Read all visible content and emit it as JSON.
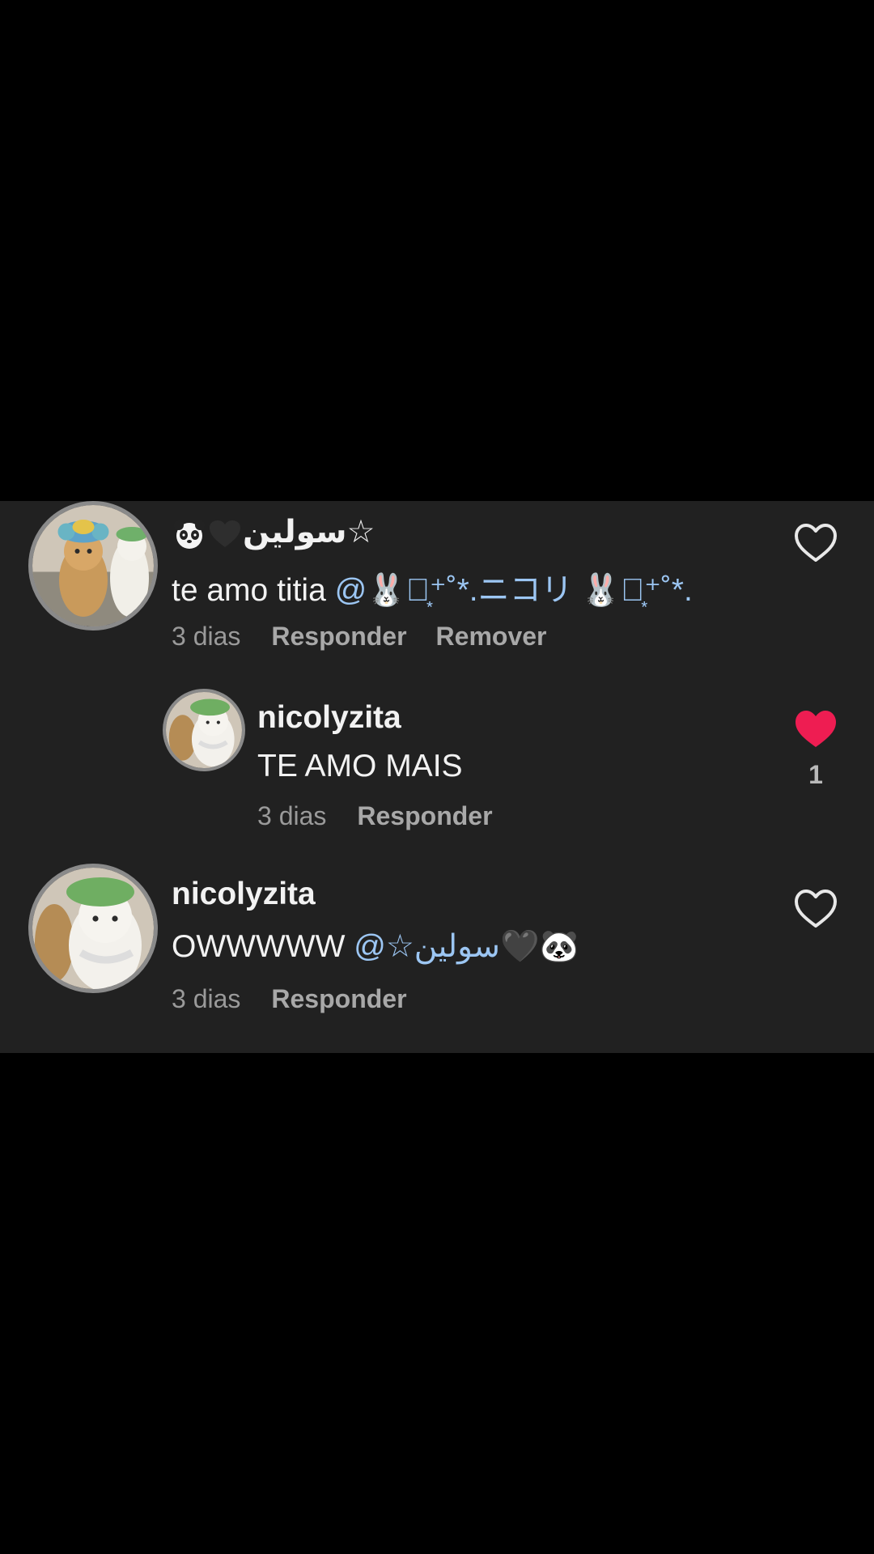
{
  "comments": [
    {
      "username": "سولين☆",
      "text": "te amo titia ",
      "mention": "@🐰‧͙⁺˚*.ニコリ 🐰‧͙⁺˚*.",
      "time": "3 dias",
      "reply_label": "Responder",
      "remove_label": "Remover",
      "liked": false,
      "avatar_icon": "cat-avatar-icon"
    },
    {
      "username": "nicolyzita",
      "text": "TE AMO MAIS",
      "time": "3 dias",
      "reply_label": "Responder",
      "liked": true,
      "like_count": "1",
      "avatar_icon": "cat-avatar-icon"
    },
    {
      "username": "nicolyzita",
      "text": "OWWWWW ",
      "mention": "@☆سولين🖤🐼",
      "time": "3 dias",
      "reply_label": "Responder",
      "liked": false,
      "avatar_icon": "cat-avatar-icon"
    }
  ],
  "colors": {
    "background": "#000000",
    "panel": "#212121",
    "mention": "#9cc6f3",
    "liked_heart": "#ee1d52"
  }
}
